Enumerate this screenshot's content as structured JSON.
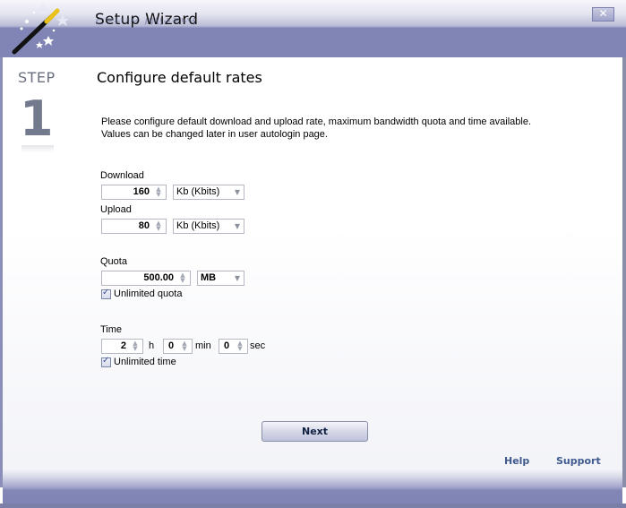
{
  "window": {
    "title": "Setup Wizard",
    "close_label": "✕"
  },
  "step": {
    "label": "STEP",
    "number": "1"
  },
  "page": {
    "heading": "Configure default rates",
    "description_line1": "Please configure default download and upload rate, maximum bandwidth quota  and time available.",
    "description_line2": "Values can be changed later in user autologin page."
  },
  "download": {
    "label": "Download",
    "value": "160",
    "unit": "Kb (Kbits)"
  },
  "upload": {
    "label": "Upload",
    "value": "80",
    "unit": "Kb (Kbits)"
  },
  "quota": {
    "label": "Quota",
    "value": "500.00",
    "unit": "MB",
    "unlimited_label": "Unlimited quota",
    "unlimited_checked": true
  },
  "time": {
    "label": "Time",
    "hours": "2",
    "hours_unit": "h",
    "minutes": "0",
    "minutes_unit": "min",
    "seconds": "0",
    "seconds_unit": "sec",
    "unlimited_label": "Unlimited time",
    "unlimited_checked": true
  },
  "buttons": {
    "next": "Next"
  },
  "links": {
    "help": "Help",
    "support": "Support"
  },
  "icons": {
    "spin": "▲▼",
    "dropdown": "▼",
    "check": "✓"
  },
  "colors": {
    "header_band": "#8185b5",
    "link": "#3f5a8e",
    "step_number": "#747a8e"
  }
}
